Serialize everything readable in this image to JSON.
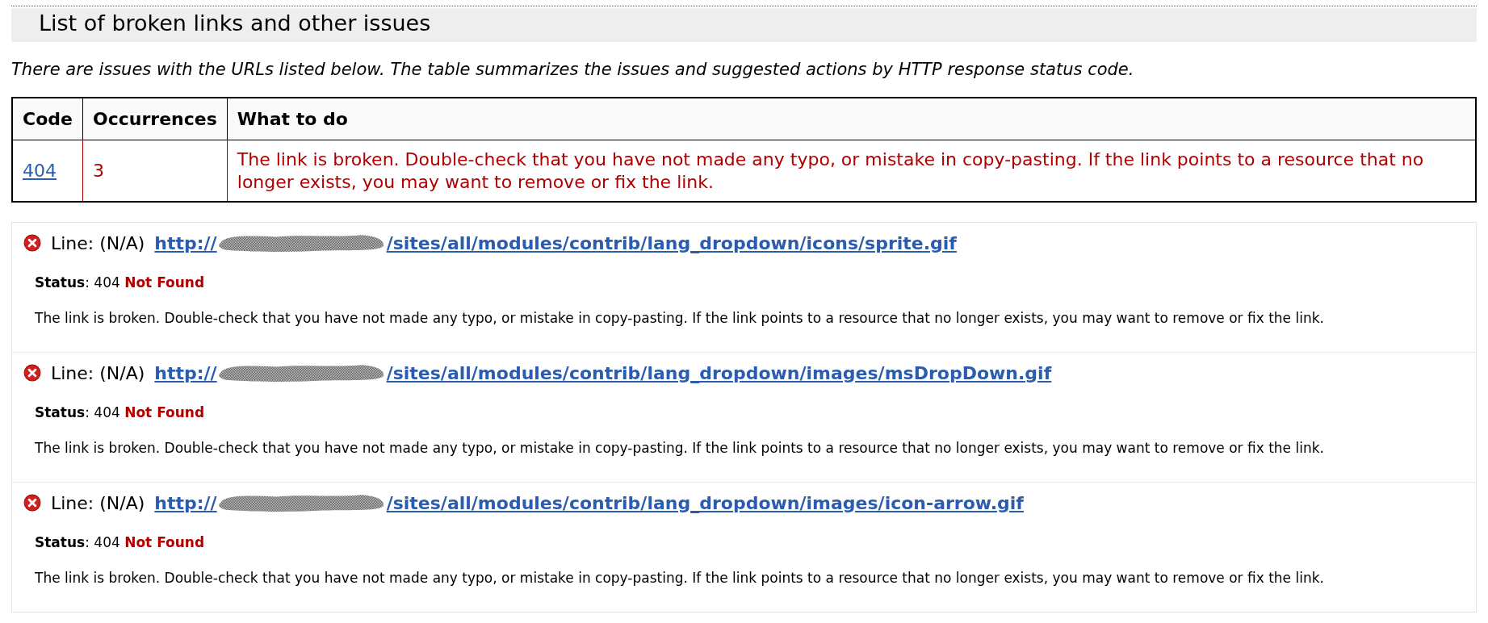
{
  "heading": "List of broken links and other issues",
  "intro": "There are issues with the URLs listed below. The table summarizes the issues and suggested actions by HTTP response status code.",
  "table": {
    "columns": [
      "Code",
      "Occurrences",
      "What to do"
    ],
    "rows": [
      {
        "code": "404",
        "occurrences": "3",
        "action": "The link is broken. Double-check that you have not made any typo, or mistake in copy-pasting. If the link points to a resource that no longer exists, you may want to remove or fix the link."
      }
    ]
  },
  "issues": [
    {
      "kind": "error",
      "line": "Line: (N/A)",
      "url_start": "http://",
      "url_end": "/sites/all/modules/contrib/lang_dropdown/icons/sprite.gif",
      "status_label": "Status",
      "status_code": ": 404",
      "status_text": "Not Found",
      "description": "The link is broken. Double-check that you have not made any typo, or mistake in copy-pasting. If the link points to a resource that no longer exists, you may want to remove or fix the link."
    },
    {
      "kind": "error",
      "line": "Line: (N/A)",
      "url_start": "http://",
      "url_end": "/sites/all/modules/contrib/lang_dropdown/images/msDropDown.gif",
      "status_label": "Status",
      "status_code": ": 404",
      "status_text": "Not Found",
      "description": "The link is broken. Double-check that you have not made any typo, or mistake in copy-pasting. If the link points to a resource that no longer exists, you may want to remove or fix the link."
    },
    {
      "kind": "error",
      "line": "Line: (N/A)",
      "url_start": "http://",
      "url_end": "/sites/all/modules/contrib/lang_dropdown/images/icon-arrow.gif",
      "status_label": "Status",
      "status_code": ": 404",
      "status_text": "Not Found",
      "description": "The link is broken. Double-check that you have not made any typo, or mistake in copy-pasting. If the link points to a resource that no longer exists, you may want to remove or fix the link."
    }
  ]
}
